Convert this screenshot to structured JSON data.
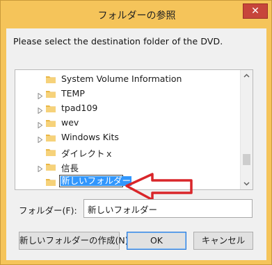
{
  "window": {
    "title": "フォルダーの参照",
    "close_glyph": "✕"
  },
  "instruction": "Please select the destination folder of the DVD.",
  "tree": {
    "items": [
      {
        "label": "System Volume Information",
        "expandable": false
      },
      {
        "label": "TEMP",
        "expandable": true
      },
      {
        "label": "tpad109",
        "expandable": true
      },
      {
        "label": "wev",
        "expandable": true
      },
      {
        "label": "Windows Kits",
        "expandable": true
      },
      {
        "label": "ダイレクトｘ",
        "expandable": false
      },
      {
        "label": "信長",
        "expandable": true
      }
    ],
    "editing_item": {
      "value": "新しいフォルダー"
    }
  },
  "folder_field": {
    "label": "フォルダー(F):",
    "value": "新しいフォルダー"
  },
  "buttons": {
    "new_folder": "新しいフォルダーの作成(N)",
    "ok": "OK",
    "cancel": "キャンセル"
  },
  "colors": {
    "title_frame": "#f5c45a",
    "close_button": "#c7453b",
    "selection": "#3297fd",
    "annotation_arrow": "#d9262a"
  }
}
